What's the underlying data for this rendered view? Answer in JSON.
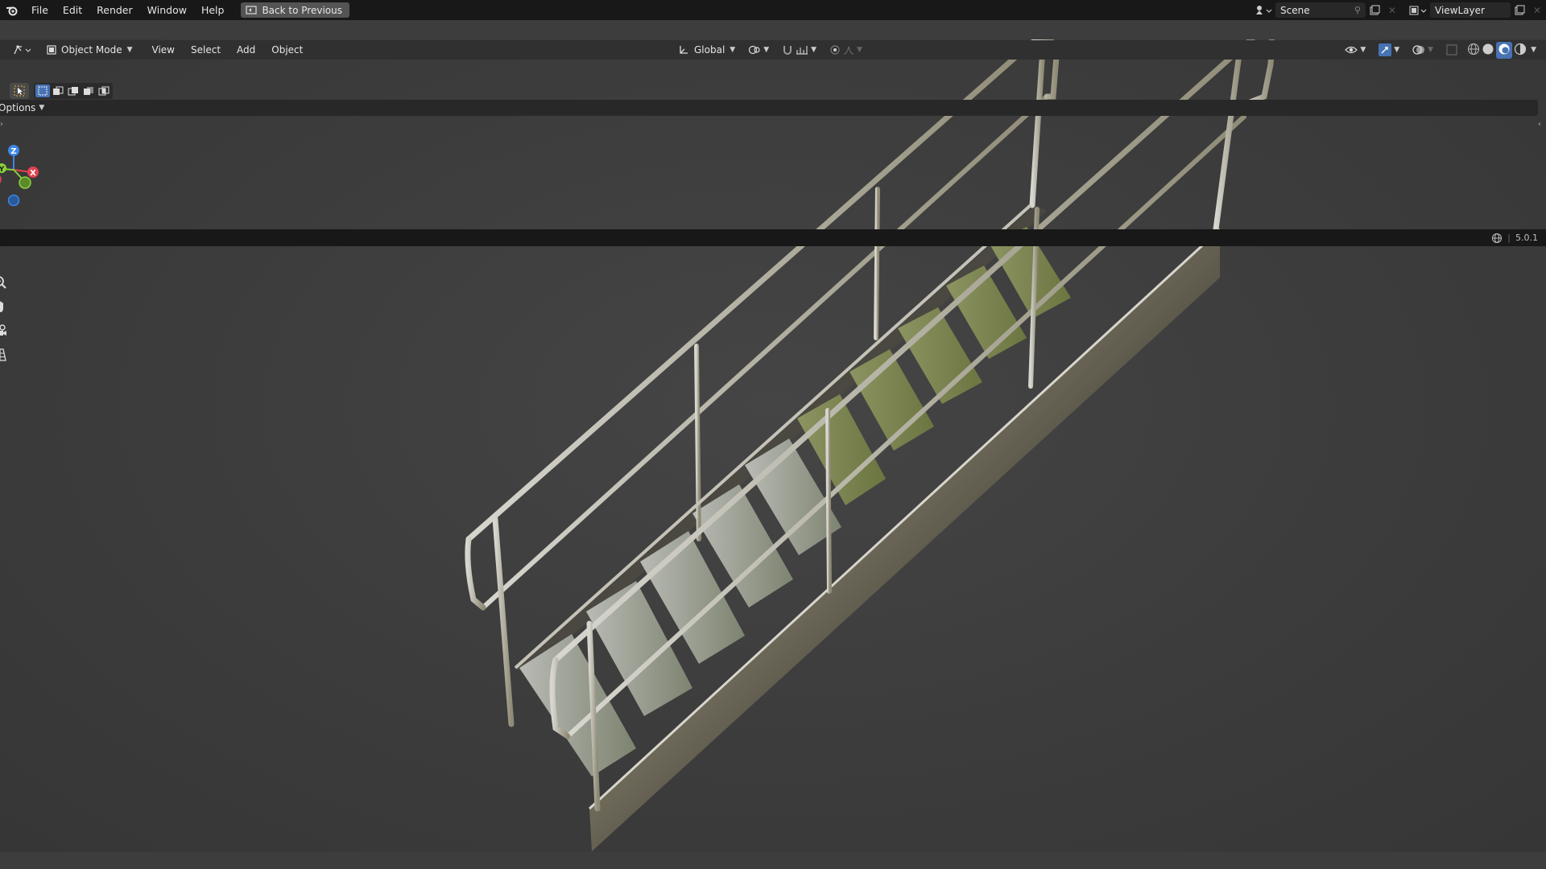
{
  "topbar": {
    "menus": [
      "File",
      "Edit",
      "Render",
      "Window",
      "Help"
    ],
    "back_label": "Back to Previous",
    "scene_name": "Scene",
    "view_layer_name": "ViewLayer"
  },
  "header": {
    "mode_label": "Object Mode",
    "menus": [
      "View",
      "Select",
      "Add",
      "Object"
    ],
    "orientation_label": "Global"
  },
  "toolbar": {
    "options_label": "Options"
  },
  "gizmo": {
    "axis_z": "Z",
    "axis_y": "Y",
    "axis_x": "X",
    "colors": {
      "x": "#e2424f",
      "y": "#8bd13b",
      "z": "#3b87e7"
    }
  },
  "nav_tools": [
    "zoom-icon",
    "hand-pan-icon",
    "camera-icon",
    "grid-perspective-icon"
  ],
  "statusbar": {
    "version": "5.0.1"
  },
  "colors": {
    "accent": "#4772b3",
    "topbar_bg": "#181818",
    "header_bg": "#303030",
    "viewport_bg": "#3d3d3d"
  }
}
